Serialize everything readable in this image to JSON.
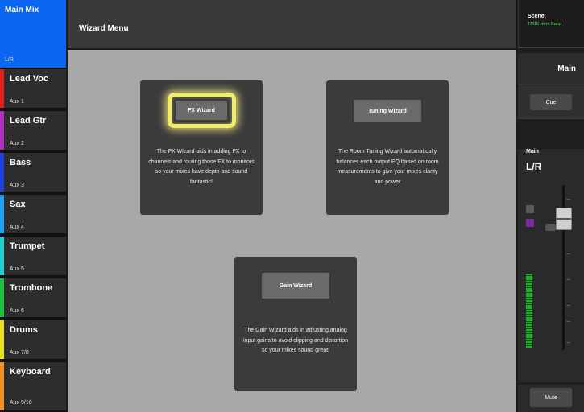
{
  "header": {
    "title": "Wizard Menu"
  },
  "mixes": [
    {
      "name": "Main Mix",
      "sub": "L/R",
      "color": "#0a66f2"
    },
    {
      "name": "Lead Voc",
      "sub": "Aux 1",
      "color": "#e02020"
    },
    {
      "name": "Lead Gtr",
      "sub": "Aux 2",
      "color": "#b030c0"
    },
    {
      "name": "Bass",
      "sub": "Aux 3",
      "color": "#2040e0"
    },
    {
      "name": "Sax",
      "sub": "Aux 4",
      "color": "#20a0f0"
    },
    {
      "name": "Trumpet",
      "sub": "Aux 5",
      "color": "#20d0d0"
    },
    {
      "name": "Trombone",
      "sub": "Aux 6",
      "color": "#20c040"
    },
    {
      "name": "Drums",
      "sub": "Aux 7/8",
      "color": "#e8e020"
    },
    {
      "name": "Keyboard",
      "sub": "Aux 9/10",
      "color": "#f09020"
    }
  ],
  "wizards": {
    "fx": {
      "button": "FX Wizard",
      "description": "The FX Wizard aids in adding FX to channels and routing those FX to monitors so your mixes have depth and sound fantastic!"
    },
    "tuning": {
      "button": "Tuning Wizard",
      "description": "The Room Tuning Wizard automatically balances each output EQ based on room measurements to give your mixes clarity and power"
    },
    "gain": {
      "button": "Gain Wizard",
      "description": "The Gain Wizard aids in adjusting analog input gains to avoid clipping and distortion so your mixes sound great!"
    }
  },
  "right": {
    "scene_label": "Scene:",
    "scene_name": "TM16 Horn Band",
    "main_label": "Main",
    "cue_button": "Cue",
    "channel_small": "Main",
    "channel_big": "L/R",
    "mute_button": "Mute"
  },
  "colors": {
    "highlight": "#f0ee6a",
    "active": "#0a66f2",
    "scene_text": "#62e065"
  }
}
